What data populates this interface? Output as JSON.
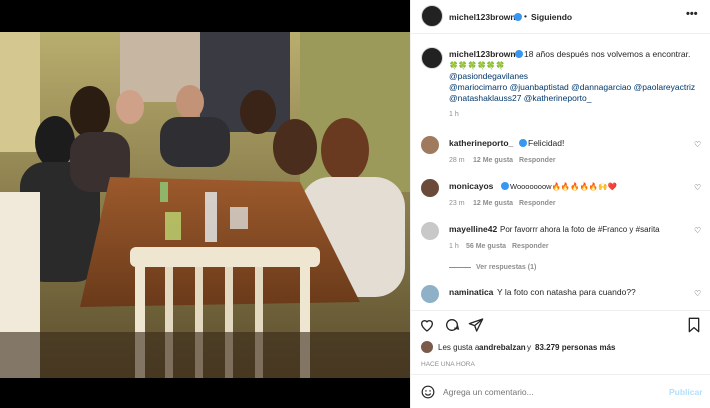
{
  "post": {
    "username": "michel123brown",
    "follow_status": "Siguiendo",
    "more_icon": "more-horizontal-icon"
  },
  "caption": {
    "username": "michel123brown",
    "text": "18 años después nos volvemos a encontrar.",
    "emoji": "🍀🍀🍀🍀🍀🍀",
    "mention_1": "@pasiondegavilanes",
    "mentions_line_2": "@mariocimarro @juanbaptistad @dannagarciao @paolareyactriz",
    "mentions_line_3": "@natashaklauss27 @katherineporto_",
    "time": "1 h"
  },
  "comments": [
    {
      "username": "katherineporto_",
      "text": "Felicidad!",
      "time": "28 m",
      "likes": "12 Me gusta",
      "reply": "Responder"
    },
    {
      "username": "monicayos",
      "text": "Wooooooow🔥🔥🔥🔥🔥🙌❤️",
      "time": "23 m",
      "likes": "12 Me gusta",
      "reply": "Responder"
    },
    {
      "username": "mayelline42",
      "text": "Por favorrr ahora la foto de #Franco y #sarita",
      "time": "1 h",
      "likes": "56 Me gusta",
      "reply": "Responder",
      "view_replies": "Ver respuestas (1)"
    },
    {
      "username": "naminatica",
      "text": "Y la foto con natasha para cuando??"
    }
  ],
  "actions": {
    "likes_prefix": "Les gusta a",
    "likes_user": "andrebalzan",
    "likes_connector": "y",
    "likes_count": "83.279 personas más",
    "time_ago": "HACE UNA HORA"
  },
  "comment_box": {
    "placeholder": "Agrega un comentario...",
    "publish": "Publicar"
  },
  "colors": {
    "verified": "#3897f0",
    "link": "#00376b",
    "publish": "#b2dffc"
  }
}
